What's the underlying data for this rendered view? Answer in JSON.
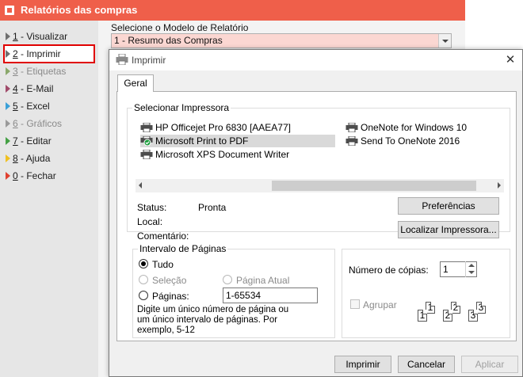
{
  "app": {
    "title": "Relatórios das compras",
    "menu": [
      {
        "num": "1",
        "label": " - Visualizar",
        "color": "#6f6f6f",
        "disabled": false
      },
      {
        "num": "2",
        "label": " - Imprimir",
        "color": "#6f6f6f",
        "disabled": false,
        "active": true
      },
      {
        "num": "3",
        "label": " - Etiquetas",
        "color": "#8aa86b",
        "disabled": true
      },
      {
        "num": "4",
        "label": " - E-Mail",
        "color": "#a04a6a",
        "disabled": false
      },
      {
        "num": "5",
        "label": " - Excel",
        "color": "#3aa0d8",
        "disabled": false
      },
      {
        "num": "6",
        "label": " - Gráficos",
        "color": "#9a9a9a",
        "disabled": true
      },
      {
        "num": "7",
        "label": " - Editar",
        "color": "#44a044",
        "disabled": false
      },
      {
        "num": "8",
        "label": " - Ajuda",
        "color": "#f0c020",
        "disabled": false
      },
      {
        "num": "0",
        "label": " - Fechar",
        "color": "#e04030",
        "disabled": false
      }
    ],
    "model_label": "Selecione o Modelo de Relatório",
    "model_value": "1 - Resumo das Compras"
  },
  "dialog": {
    "title": "Imprimir",
    "close": "✕",
    "tab": "Geral",
    "select_printer_title": "Selecionar Impressora",
    "printers": [
      {
        "name": "HP Officejet Pro 6830 [AAEA77]",
        "selected": false
      },
      {
        "name": "Microsoft Print to PDF",
        "selected": true
      },
      {
        "name": "Microsoft XPS Document Writer",
        "selected": false
      },
      {
        "name": "OneNote for Windows 10",
        "selected": false
      },
      {
        "name": "Send To OneNote 2016",
        "selected": false
      }
    ],
    "status_label": "Status:",
    "status_value": "Pronta",
    "local_label": "Local:",
    "comment_label": "Comentário:",
    "prefs_button": "Preferências",
    "find_printer_button": "Localizar Impressora...",
    "range": {
      "title": "Intervalo de Páginas",
      "all": "Tudo",
      "selection": "Seleção",
      "current_page": "Página Atual",
      "pages": "Páginas:",
      "pages_value": "1-65534",
      "hint": "Digite um único número de página ou um único intervalo de páginas. Por exemplo, 5-12"
    },
    "copies": {
      "label": "Número de cópias:",
      "value": "1",
      "collate": "Agrupar",
      "collate_pages": [
        "1",
        "1",
        "2",
        "2",
        "3",
        "3"
      ]
    },
    "buttons": {
      "print": "Imprimir",
      "cancel": "Cancelar",
      "apply": "Aplicar"
    }
  }
}
